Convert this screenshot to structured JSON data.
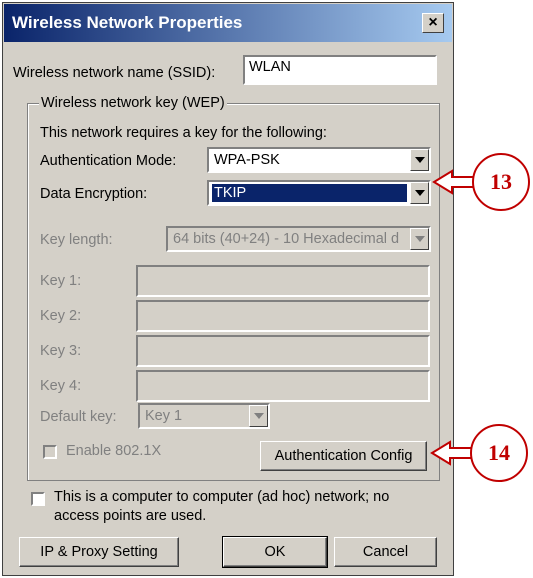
{
  "window": {
    "title": "Wireless Network Properties",
    "close_label": "×"
  },
  "ssid": {
    "label": "Wireless network name (SSID):",
    "value": "WLAN"
  },
  "wep_group": {
    "label": "Wireless network key (WEP)",
    "requires_text": "This network requires a key for the following:",
    "auth_mode": {
      "label": "Authentication Mode:",
      "value": "WPA-PSK"
    },
    "data_encryption": {
      "label": "Data Encryption:",
      "value": "TKIP"
    },
    "key_length": {
      "label": "Key length:",
      "value": "64 bits (40+24) - 10 Hexadecimal d"
    },
    "keys": [
      {
        "label": "Key 1:",
        "value": ""
      },
      {
        "label": "Key 2:",
        "value": ""
      },
      {
        "label": "Key 3:",
        "value": ""
      },
      {
        "label": "Key 4:",
        "value": ""
      }
    ],
    "default_key": {
      "label": "Default key:",
      "value": "Key 1"
    },
    "enable_8021x": {
      "label": "Enable 802.1X",
      "checked": false,
      "enabled": false
    },
    "auth_config_button": "Authentication Config"
  },
  "adhoc": {
    "label_line1": "This is a computer to computer (ad hoc) network; no",
    "label_line2": "access points are used.",
    "checked": false
  },
  "buttons": {
    "ip_proxy": "IP & Proxy Setting",
    "ok": "OK",
    "cancel": "Cancel"
  },
  "annotations": [
    {
      "number": "13",
      "target": "data-encryption-select"
    },
    {
      "number": "14",
      "target": "authentication-config-button"
    }
  ],
  "colors": {
    "title_bar": "#0a246a",
    "dialog_bg": "#d4d0c8",
    "callout": "#c00000"
  }
}
